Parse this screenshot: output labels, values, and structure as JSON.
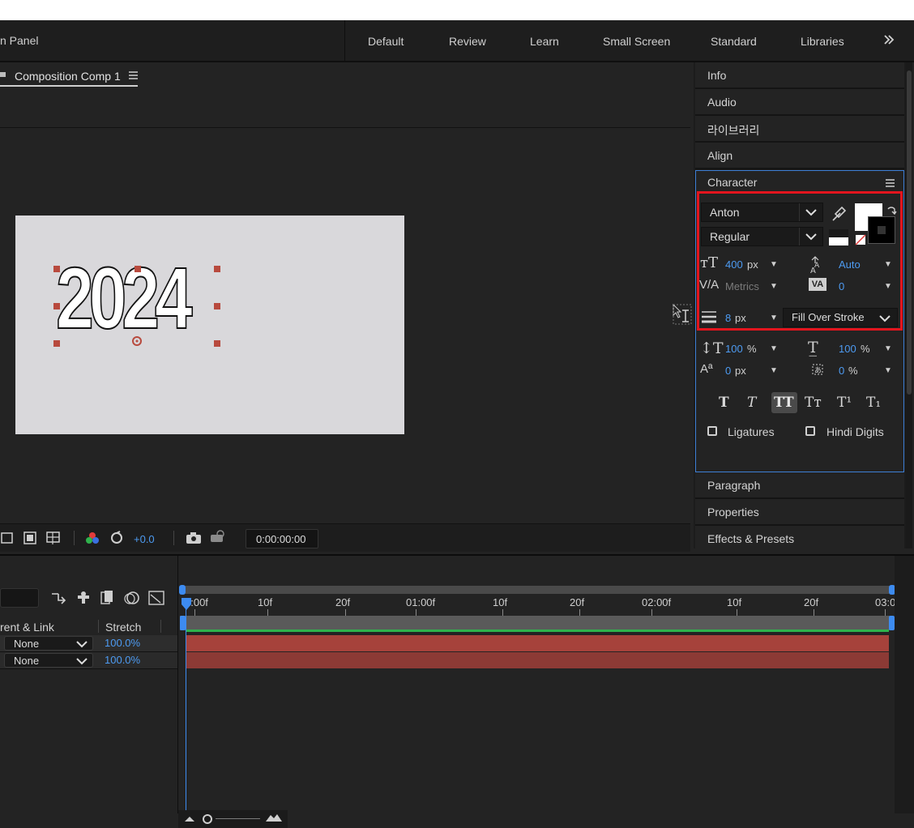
{
  "header": {
    "panel_title": "n Panel",
    "workspaces": [
      "Default",
      "Review",
      "Learn",
      "Small Screen",
      "Standard",
      "Libraries"
    ],
    "more_icon": "chevrons-right-icon"
  },
  "composition": {
    "tab_label": "Composition Comp 1",
    "canvas_text": "2024",
    "toolbar": {
      "exposure": "+0.0",
      "timecode": "0:00:00:00"
    }
  },
  "panels": {
    "top": [
      "Info",
      "Audio",
      "라이브러리",
      "Align"
    ],
    "bottom": [
      "Paragraph",
      "Properties",
      "Effects & Presets"
    ]
  },
  "character": {
    "title": "Character",
    "font_family": "Anton",
    "font_style": "Regular",
    "font_size": "400",
    "font_size_unit": "px",
    "leading": "Auto",
    "kerning": "Metrics",
    "tracking": "0",
    "stroke_width": "8",
    "stroke_unit": "px",
    "stroke_mode": "Fill Over Stroke",
    "vertical_scale": "100",
    "horizontal_scale": "100",
    "percent": "%",
    "baseline_shift": "0",
    "baseline_unit": "px",
    "tsume": "0",
    "ligatures": "Ligatures",
    "hindi_digits": "Hindi Digits",
    "fill_color": "#ffffff",
    "stroke_color": "#000000"
  },
  "timeline": {
    "col_parent": "rent & Link",
    "col_stretch": "Stretch",
    "rows": [
      {
        "parent": "None",
        "stretch": "100.0%"
      },
      {
        "parent": "None",
        "stretch": "100.0%"
      }
    ],
    "ruler": [
      "0:00f",
      "10f",
      "20f",
      "01:00f",
      "10f",
      "20f",
      "02:00f",
      "10f",
      "20f",
      "03:0"
    ]
  },
  "colors": {
    "accent": "#4d9bf2",
    "highlight": "#e3151e",
    "layer_bar": "#a6423b"
  }
}
